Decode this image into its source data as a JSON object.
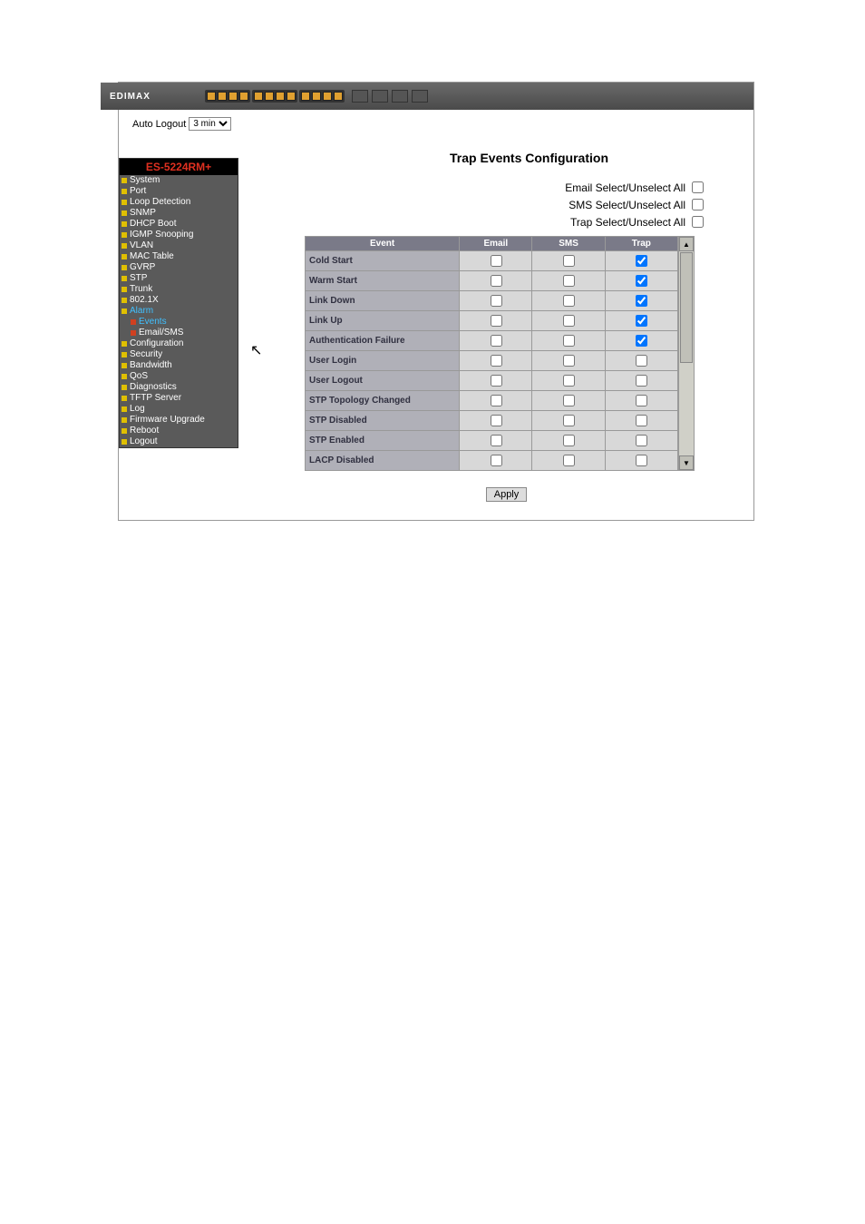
{
  "brand": "EDIMAX",
  "brand_small": "EDIMAX",
  "auto_logout_label": "Auto Logout",
  "auto_logout_value": "3 min",
  "device_model": "ES-5224RM+",
  "nav": {
    "items": [
      {
        "label": "System",
        "bullet": "yellow"
      },
      {
        "label": "Port",
        "bullet": "yellow"
      },
      {
        "label": "Loop Detection",
        "bullet": "yellow"
      },
      {
        "label": "SNMP",
        "bullet": "yellow"
      },
      {
        "label": "DHCP Boot",
        "bullet": "yellow"
      },
      {
        "label": "IGMP Snooping",
        "bullet": "yellow"
      },
      {
        "label": "VLAN",
        "bullet": "yellow"
      },
      {
        "label": "MAC Table",
        "bullet": "yellow"
      },
      {
        "label": "GVRP",
        "bullet": "yellow"
      },
      {
        "label": "STP",
        "bullet": "yellow"
      },
      {
        "label": "Trunk",
        "bullet": "yellow"
      },
      {
        "label": "802.1X",
        "bullet": "yellow"
      },
      {
        "label": "Alarm",
        "bullet": "yellow",
        "highlight": true
      },
      {
        "label": "Events",
        "bullet": "red",
        "sub": true,
        "highlight": true
      },
      {
        "label": "Email/SMS",
        "bullet": "red",
        "sub": true
      },
      {
        "label": "Configuration",
        "bullet": "yellow"
      },
      {
        "label": "Security",
        "bullet": "yellow"
      },
      {
        "label": "Bandwidth",
        "bullet": "yellow"
      },
      {
        "label": "QoS",
        "bullet": "yellow"
      },
      {
        "label": "Diagnostics",
        "bullet": "yellow"
      },
      {
        "label": "TFTP Server",
        "bullet": "yellow"
      },
      {
        "label": "Log",
        "bullet": "yellow"
      },
      {
        "label": "Firmware Upgrade",
        "bullet": "yellow"
      },
      {
        "label": "Reboot",
        "bullet": "yellow"
      },
      {
        "label": "Logout",
        "bullet": "yellow"
      }
    ]
  },
  "content": {
    "title": "Trap Events Configuration",
    "select_all": {
      "email": "Email Select/Unselect All",
      "sms": "SMS Select/Unselect All",
      "trap": "Trap Select/Unselect All"
    },
    "table": {
      "headers": [
        "Event",
        "Email",
        "SMS",
        "Trap"
      ],
      "rows": [
        {
          "event": "Cold Start",
          "email": false,
          "sms": false,
          "trap": true
        },
        {
          "event": "Warm Start",
          "email": false,
          "sms": false,
          "trap": true
        },
        {
          "event": "Link Down",
          "email": false,
          "sms": false,
          "trap": true
        },
        {
          "event": "Link Up",
          "email": false,
          "sms": false,
          "trap": true
        },
        {
          "event": "Authentication Failure",
          "email": false,
          "sms": false,
          "trap": true
        },
        {
          "event": "User Login",
          "email": false,
          "sms": false,
          "trap": false
        },
        {
          "event": "User Logout",
          "email": false,
          "sms": false,
          "trap": false
        },
        {
          "event": "STP Topology Changed",
          "email": false,
          "sms": false,
          "trap": false
        },
        {
          "event": "STP Disabled",
          "email": false,
          "sms": false,
          "trap": false
        },
        {
          "event": "STP Enabled",
          "email": false,
          "sms": false,
          "trap": false
        },
        {
          "event": "LACP Disabled",
          "email": false,
          "sms": false,
          "trap": false
        }
      ]
    },
    "apply_button": "Apply"
  }
}
